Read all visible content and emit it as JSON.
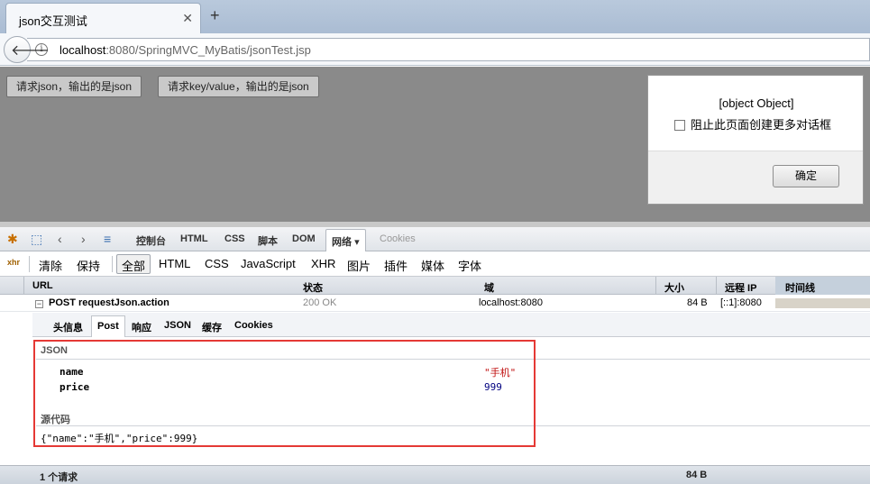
{
  "browser": {
    "tab_title": "json交互测试",
    "url_host": "localhost",
    "url_path": ":8080/SpringMVC_MyBatis/jsonTest.jsp"
  },
  "page": {
    "button_json": "请求json，输出的是json",
    "button_kv": "请求key/value，输出的是json"
  },
  "dialog": {
    "message": "[object Object]",
    "checkbox_label": "阻止此页面创建更多对话框",
    "ok_label": "确定"
  },
  "firebug": {
    "tabs": [
      "控制台",
      "HTML",
      "CSS",
      "脚本",
      "DOM",
      "网络",
      "Cookies"
    ],
    "selected_tab": "网络",
    "filters": [
      "清除",
      "保持",
      "全部",
      "HTML",
      "CSS",
      "JavaScript",
      "XHR",
      "图片",
      "插件",
      "媒体",
      "字体"
    ],
    "selected_filter": "全部",
    "columns": [
      "URL",
      "状态",
      "域",
      "大小",
      "远程 IP",
      "时间线"
    ],
    "request": {
      "url": "POST requestJson.action",
      "status": "200 OK",
      "domain": "localhost:8080",
      "size": "84 B",
      "remote_ip": "[::1]:8080"
    },
    "subtabs": [
      "头信息",
      "Post",
      "响应",
      "JSON",
      "缓存",
      "Cookies"
    ],
    "selected_subtab": "Post",
    "post": {
      "json_heading": "JSON",
      "params": [
        {
          "name": "name",
          "value": "\"手机\""
        },
        {
          "name": "price",
          "value": "999"
        }
      ],
      "source_heading": "源代码",
      "source": "{\"name\":\"手机\",\"price\":999}"
    },
    "status_bar": {
      "requests": "1 个请求",
      "total_size": "84 B"
    }
  },
  "colors": {
    "highlight_box": "#e53935",
    "string_value": "#c01010",
    "number_value": "#000080"
  }
}
